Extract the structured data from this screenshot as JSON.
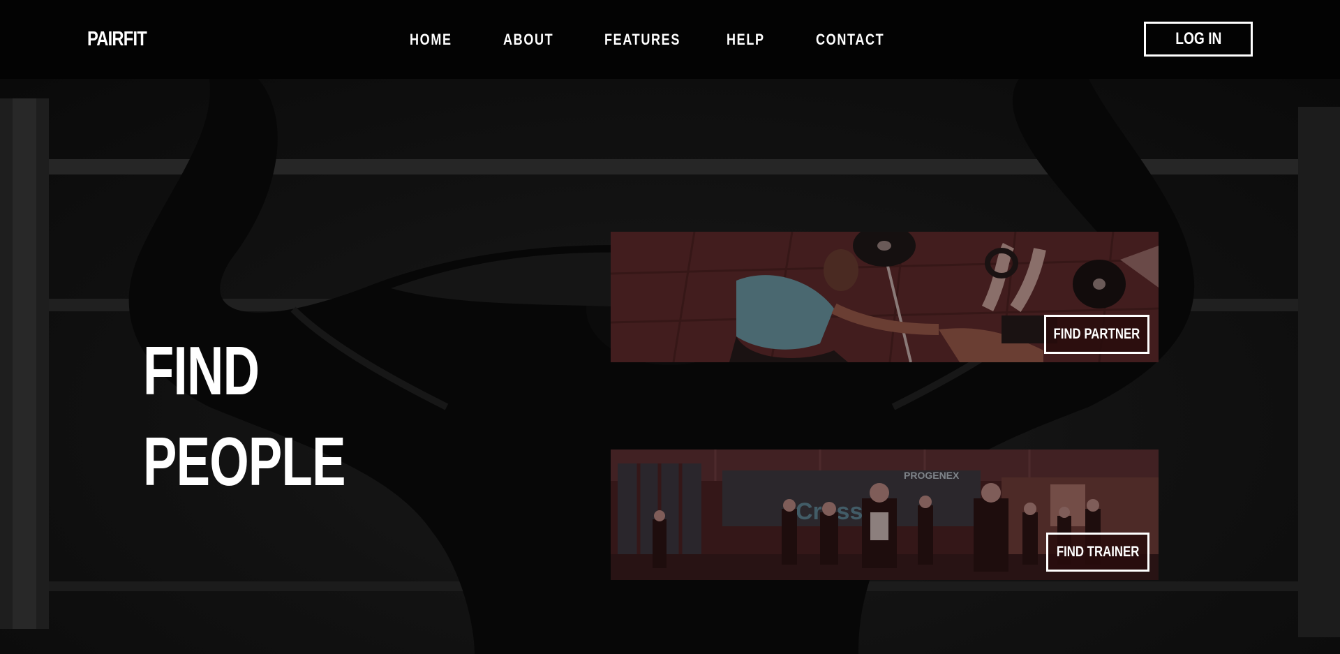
{
  "brand": {
    "logo": "PAIRFIT"
  },
  "nav": {
    "items": [
      {
        "label": "HOME"
      },
      {
        "label": "ABOUT"
      },
      {
        "label": "FEATURES"
      },
      {
        "label": "HELP"
      },
      {
        "label": "CONTACT"
      }
    ],
    "login_label": "LOG IN"
  },
  "hero": {
    "headline_line1": "FIND",
    "headline_line2": "PEOPLE"
  },
  "cards": {
    "partner": {
      "button_label": "FIND PARTNER",
      "gym_sign": ""
    },
    "trainer": {
      "button_label": "FIND TRAINER",
      "gym_sign_1": "PROGENEX",
      "gym_sign_2": "CrossFit"
    }
  },
  "colors": {
    "header_bg": "#030303",
    "card_tint": "#5a1f1f",
    "text": "#ffffff"
  }
}
